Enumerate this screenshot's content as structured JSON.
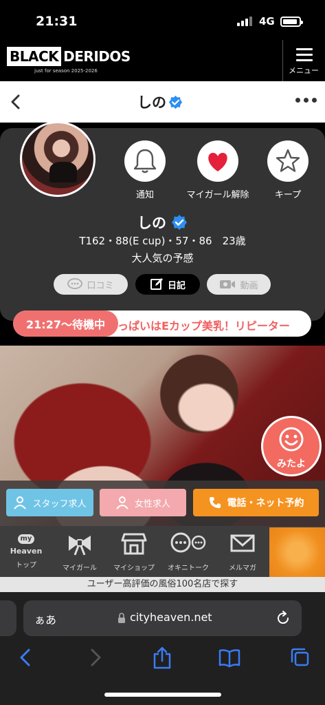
{
  "status_bar": {
    "time": "21:31",
    "network": "4G"
  },
  "site_header": {
    "logo_part1": "BLACK",
    "logo_part2": "DERIDOS",
    "logo_sub": "just for season 2025-2026",
    "menu_label": "メニュー"
  },
  "nav": {
    "title": "しの"
  },
  "profile": {
    "name": "しの",
    "stats": "T162・88(E cup)・57・86　23歳",
    "tagline": "大人気の予感",
    "actions": [
      {
        "label": "通知",
        "icon": "bell-icon"
      },
      {
        "label": "マイガール解除",
        "icon": "heart-icon"
      },
      {
        "label": "キープ",
        "icon": "star-icon"
      }
    ],
    "pills": {
      "review": "口コミ",
      "diary": "日記",
      "video": "動画"
    }
  },
  "ticker": {
    "badge": "21:27〜待機中",
    "text": "っぱいはEカップ美乳！リピーター"
  },
  "mitayo": {
    "label": "みたよ"
  },
  "recruit": {
    "staff": "スタッフ求人",
    "female": "女性求人",
    "reserve": "電話・ネット予約"
  },
  "tabbar": {
    "top_logo_my": "my",
    "top_logo_heaven": "Heaven",
    "tabs": [
      "トップ",
      "マイガール",
      "マイショップ",
      "オキニトーク",
      "メルマガ"
    ]
  },
  "search_banner": "ユーザー高評価の風俗100名店で探す",
  "safari": {
    "aa": "ぁあ",
    "url": "cityheaven.net"
  },
  "colors": {
    "verified_blue": "#2d8ff0",
    "heart_red": "#e5203a",
    "ticker_red": "#f07070",
    "staff_blue": "#6fc4e6",
    "female_pink": "#f3a9ad",
    "reserve_orange": "#f59320",
    "safari_blue": "#3a7cf5"
  }
}
